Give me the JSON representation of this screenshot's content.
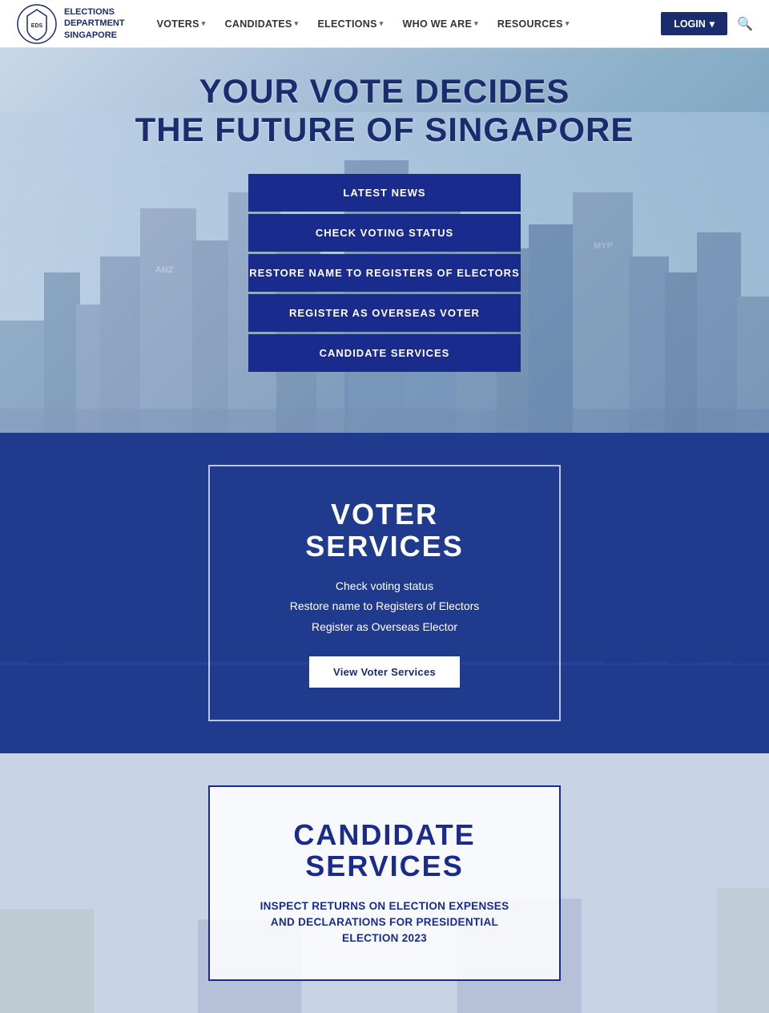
{
  "nav": {
    "logo_line1": "ELECTIONS",
    "logo_line2": "DEPARTMENT",
    "logo_line3": "SINGAPORE",
    "links": [
      {
        "label": "VOTERS",
        "id": "voters"
      },
      {
        "label": "CANDIDATES",
        "id": "candidates"
      },
      {
        "label": "ELECTIONS",
        "id": "elections"
      },
      {
        "label": "WHO WE ARE",
        "id": "who-we-are"
      },
      {
        "label": "RESOURCES",
        "id": "resources"
      }
    ],
    "login_label": "LOGIN",
    "search_placeholder": "Search"
  },
  "hero": {
    "title_line1": "YOUR VOTE DECIDES",
    "title_line2": "THE FUTURE OF SINGAPORE",
    "buttons": [
      {
        "label": "LATEST NEWS",
        "id": "latest-news"
      },
      {
        "label": "CHECK VOTING STATUS",
        "id": "check-voting-status"
      },
      {
        "label": "RESTORE NAME TO REGISTERS OF ELECTORS",
        "id": "restore-name"
      },
      {
        "label": "REGISTER AS OVERSEAS VOTER",
        "id": "register-overseas"
      },
      {
        "label": "CANDIDATE SERVICES",
        "id": "candidate-services-btn"
      }
    ]
  },
  "voter_services": {
    "title": "VOTER\nSERVICES",
    "items": [
      "Check voting status",
      "Restore name to Registers of Electors",
      "Register as Overseas Elector"
    ],
    "cta_label": "View Voter Services"
  },
  "candidate_services": {
    "title": "CANDIDATE\nSERVICES",
    "link_label": "INSPECT RETURNS ON ELECTION EXPENSES AND DECLARATIONS FOR PRESIDENTIAL ELECTION 2023"
  }
}
